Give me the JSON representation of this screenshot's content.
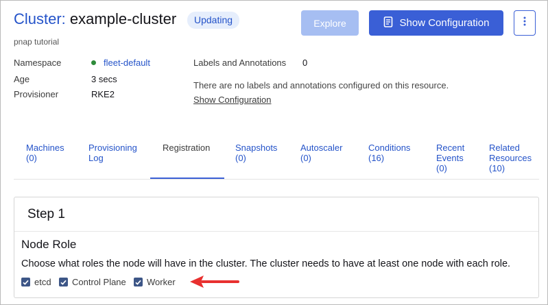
{
  "header": {
    "kind": "Cluster:",
    "name": "example-cluster",
    "status": "Updating",
    "subtitle": "pnap tutorial",
    "explore_label": "Explore",
    "show_config_label": "Show Configuration"
  },
  "details": {
    "namespace_label": "Namespace",
    "namespace_value": "fleet-default",
    "age_label": "Age",
    "age_value": "3 secs",
    "provisioner_label": "Provisioner",
    "provisioner_value": "RKE2",
    "labels_label": "Labels and Annotations",
    "labels_count": "0",
    "labels_note": "There are no labels and annotations configured on this resource.",
    "show_config_link": "Show Configuration"
  },
  "tabs": [
    {
      "line1": "Machines",
      "line2": "(0)",
      "line3": ""
    },
    {
      "line1": "Provisioning",
      "line2": "Log",
      "line3": ""
    },
    {
      "line1": "Registration",
      "line2": "",
      "line3": ""
    },
    {
      "line1": "Snapshots",
      "line2": "(0)",
      "line3": ""
    },
    {
      "line1": "Autoscaler",
      "line2": "(0)",
      "line3": ""
    },
    {
      "line1": "Conditions",
      "line2": "(16)",
      "line3": ""
    },
    {
      "line1": "Recent",
      "line2": "Events",
      "line3": "(0)"
    },
    {
      "line1": "Related",
      "line2": "Resources",
      "line3": "(10)"
    }
  ],
  "active_tab": "Registration",
  "step": {
    "title": "Step 1",
    "role_heading": "Node Role",
    "role_description": "Choose what roles the node will have in the cluster. The cluster needs to have at least one node with each role.",
    "roles": [
      {
        "label": "etcd",
        "checked": true
      },
      {
        "label": "Control Plane",
        "checked": true
      },
      {
        "label": "Worker",
        "checked": true
      }
    ]
  },
  "colors": {
    "accent": "#3a5fd6",
    "link": "#2453c9",
    "checkbox": "#3d5687",
    "annotation_arrow": "#e8302f",
    "status_dot": "#2e8b3a"
  }
}
